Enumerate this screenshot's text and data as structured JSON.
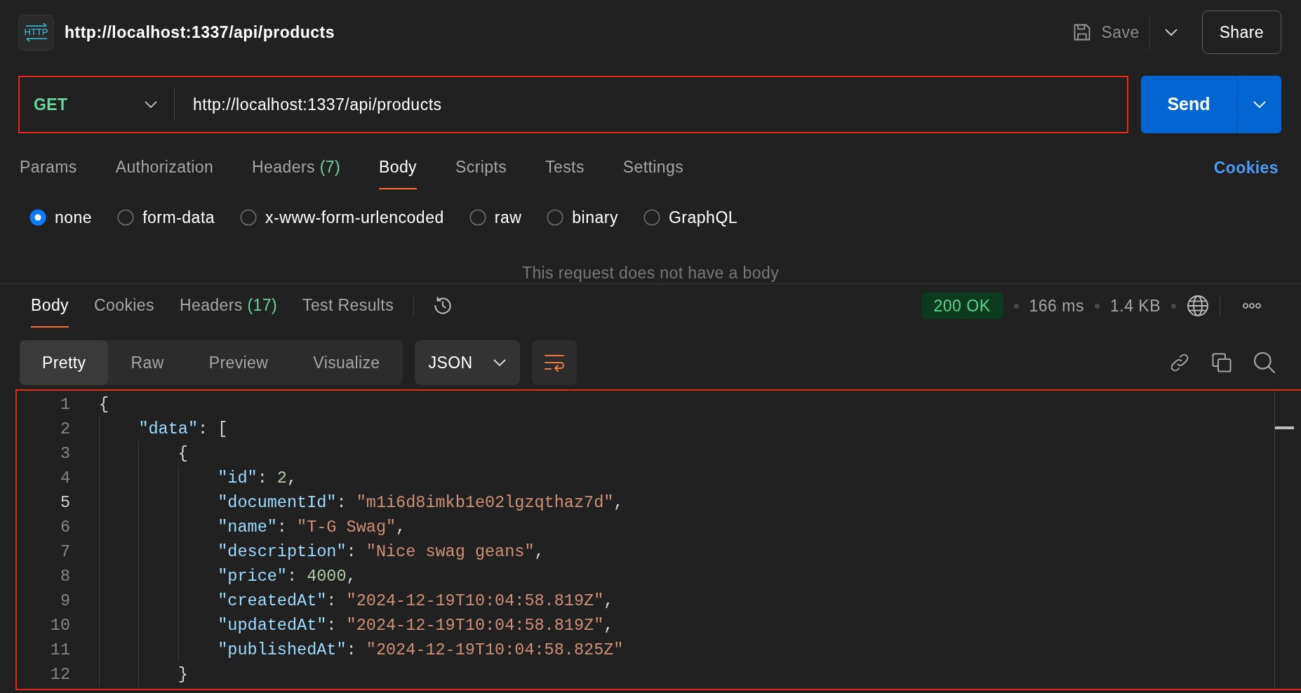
{
  "header": {
    "badge": "HTTP",
    "title": "http://localhost:1337/api/products",
    "save_label": "Save",
    "share_label": "Share"
  },
  "request": {
    "url_bar": {
      "highlighted": true,
      "method": "GET",
      "url": "http://localhost:1337/api/products"
    },
    "send_label": "Send",
    "tabs": [
      {
        "label": "Params",
        "selected": false
      },
      {
        "label": "Authorization",
        "selected": false
      },
      {
        "label": "Headers",
        "count": "(7)",
        "selected": false
      },
      {
        "label": "Body",
        "selected": true
      },
      {
        "label": "Scripts",
        "selected": false
      },
      {
        "label": "Tests",
        "selected": false
      },
      {
        "label": "Settings",
        "selected": false
      }
    ],
    "cookies_link": "Cookies",
    "body_types": [
      {
        "label": "none",
        "selected": true
      },
      {
        "label": "form-data",
        "selected": false
      },
      {
        "label": "x-www-form-urlencoded",
        "selected": false
      },
      {
        "label": "raw",
        "selected": false
      },
      {
        "label": "binary",
        "selected": false
      },
      {
        "label": "GraphQL",
        "selected": false
      }
    ],
    "empty_message": "This request does not have a body"
  },
  "response": {
    "tabs": [
      {
        "label": "Body",
        "selected": true
      },
      {
        "label": "Cookies",
        "selected": false
      },
      {
        "label": "Headers",
        "count": "(17)",
        "selected": false
      },
      {
        "label": "Test Results",
        "selected": false
      }
    ],
    "status": "200 OK",
    "time": "166 ms",
    "size": "1.4 KB",
    "view_modes": [
      {
        "label": "Pretty",
        "selected": true
      },
      {
        "label": "Raw",
        "selected": false
      },
      {
        "label": "Preview",
        "selected": false
      },
      {
        "label": "Visualize",
        "selected": false
      }
    ],
    "format": "JSON",
    "wrap_lines": true,
    "body_view": {
      "highlighted": true,
      "lines": [
        {
          "number": "1",
          "active": false,
          "tokens": [
            {
              "kind": "punct",
              "text": "{"
            }
          ],
          "children": [
            {
              "number": "2",
              "active": false,
              "tokens": [
                {
                  "kind": "key",
                  "text": "\"data\""
                },
                {
                  "kind": "punct",
                  "text": ": ["
                }
              ],
              "children": [
                {
                  "number": "3",
                  "active": false,
                  "tokens": [
                    {
                      "kind": "punct",
                      "text": "{"
                    }
                  ],
                  "children": [
                    {
                      "number": "4",
                      "active": false,
                      "tokens": [
                        {
                          "kind": "key",
                          "text": "\"id\""
                        },
                        {
                          "kind": "punct",
                          "text": ": "
                        },
                        {
                          "kind": "number",
                          "text": "2"
                        },
                        {
                          "kind": "punct",
                          "text": ","
                        }
                      ]
                    },
                    {
                      "number": "5",
                      "active": true,
                      "tokens": [
                        {
                          "kind": "key",
                          "text": "\"documentId\""
                        },
                        {
                          "kind": "punct",
                          "text": ": "
                        },
                        {
                          "kind": "string",
                          "text": "\"m1i6d8imkb1e02lgzqthaz7d\""
                        },
                        {
                          "kind": "punct",
                          "text": ","
                        }
                      ]
                    },
                    {
                      "number": "6",
                      "active": false,
                      "tokens": [
                        {
                          "kind": "key",
                          "text": "\"name\""
                        },
                        {
                          "kind": "punct",
                          "text": ": "
                        },
                        {
                          "kind": "string",
                          "text": "\"T-G Swag\""
                        },
                        {
                          "kind": "punct",
                          "text": ","
                        }
                      ]
                    },
                    {
                      "number": "7",
                      "active": false,
                      "tokens": [
                        {
                          "kind": "key",
                          "text": "\"description\""
                        },
                        {
                          "kind": "punct",
                          "text": ": "
                        },
                        {
                          "kind": "string",
                          "text": "\"Nice swag geans\""
                        },
                        {
                          "kind": "punct",
                          "text": ","
                        }
                      ]
                    },
                    {
                      "number": "8",
                      "active": false,
                      "tokens": [
                        {
                          "kind": "key",
                          "text": "\"price\""
                        },
                        {
                          "kind": "punct",
                          "text": ": "
                        },
                        {
                          "kind": "number",
                          "text": "4000"
                        },
                        {
                          "kind": "punct",
                          "text": ","
                        }
                      ]
                    },
                    {
                      "number": "9",
                      "active": false,
                      "tokens": [
                        {
                          "kind": "key",
                          "text": "\"createdAt\""
                        },
                        {
                          "kind": "punct",
                          "text": ": "
                        },
                        {
                          "kind": "string",
                          "text": "\"2024-12-19T10:04:58.819Z\""
                        },
                        {
                          "kind": "punct",
                          "text": ","
                        }
                      ]
                    },
                    {
                      "number": "10",
                      "active": false,
                      "tokens": [
                        {
                          "kind": "key",
                          "text": "\"updatedAt\""
                        },
                        {
                          "kind": "punct",
                          "text": ": "
                        },
                        {
                          "kind": "string",
                          "text": "\"2024-12-19T10:04:58.819Z\""
                        },
                        {
                          "kind": "punct",
                          "text": ","
                        }
                      ]
                    },
                    {
                      "number": "11",
                      "active": false,
                      "tokens": [
                        {
                          "kind": "key",
                          "text": "\"publishedAt\""
                        },
                        {
                          "kind": "punct",
                          "text": ": "
                        },
                        {
                          "kind": "string",
                          "text": "\"2024-12-19T10:04:58.825Z\""
                        }
                      ]
                    }
                  ]
                },
                {
                  "number": "12",
                  "active": false,
                  "tokens": [
                    {
                      "kind": "punct",
                      "text": "}"
                    }
                  ]
                }
              ]
            }
          ]
        }
      ]
    }
  }
}
